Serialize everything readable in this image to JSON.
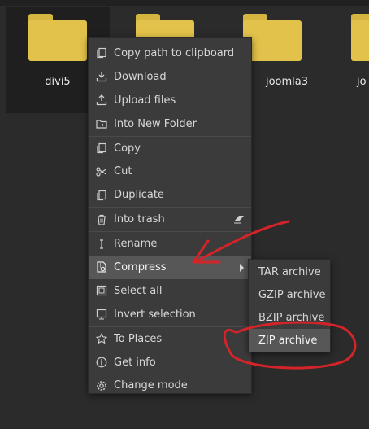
{
  "files": [
    {
      "name": "divi5",
      "selected": true
    },
    {
      "name": "",
      "selected": false
    },
    {
      "name": "joomla3",
      "selected": false
    },
    {
      "name": "jo",
      "selected": false
    }
  ],
  "context_menu": {
    "items": [
      {
        "label": "Copy path to clipboard",
        "icon": "copy-path-icon"
      },
      {
        "label": "Download",
        "icon": "download-icon"
      },
      {
        "label": "Upload files",
        "icon": "upload-icon"
      },
      {
        "label": "Into New Folder",
        "icon": "new-folder-icon"
      },
      {
        "label": "Copy",
        "icon": "copy-icon"
      },
      {
        "label": "Cut",
        "icon": "scissors-icon"
      },
      {
        "label": "Duplicate",
        "icon": "duplicate-icon"
      },
      {
        "label": "Into trash",
        "icon": "trash-icon"
      },
      {
        "label": "Rename",
        "icon": "text-cursor-icon"
      },
      {
        "label": "Compress",
        "icon": "compress-icon"
      },
      {
        "label": "Select all",
        "icon": "select-all-icon"
      },
      {
        "label": "Invert selection",
        "icon": "invert-selection-icon"
      },
      {
        "label": "To Places",
        "icon": "star-icon"
      },
      {
        "label": "Get info",
        "icon": "info-icon"
      },
      {
        "label": "Change mode",
        "icon": "gear-icon"
      }
    ]
  },
  "compress_submenu": {
    "items": [
      {
        "label": "TAR archive"
      },
      {
        "label": "GZIP archive"
      },
      {
        "label": "BZIP archive"
      },
      {
        "label": "ZIP archive"
      }
    ]
  },
  "colors": {
    "background": "#2b2b2b",
    "folder": "#e2c24a",
    "menu": "#3b3b3b",
    "highlight": "#575757",
    "annotation": "#d4242a"
  }
}
